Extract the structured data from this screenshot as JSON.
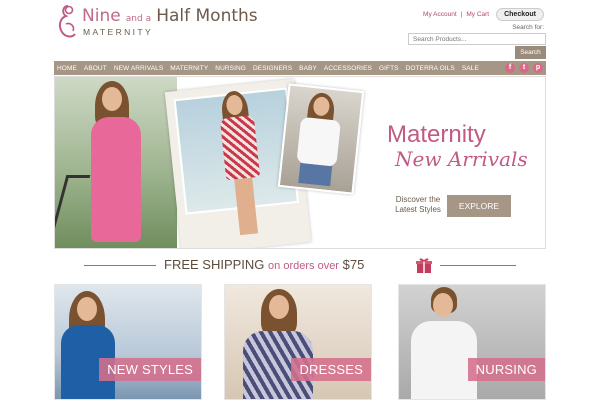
{
  "brand": {
    "name_part1": "Nine",
    "name_connector": "and a",
    "name_part2": "Half Months",
    "tagline": "MATERNITY",
    "accent_color": "#c25a86",
    "nav_color": "#a59686"
  },
  "header": {
    "my_account": "My Account",
    "separator": "|",
    "my_cart": "My Cart",
    "checkout": "Checkout",
    "search_for": "Search for:",
    "search_placeholder": "Search Products...",
    "search_button": "Search"
  },
  "nav": {
    "items": [
      "HOME",
      "ABOUT",
      "NEW ARRIVALS",
      "MATERNITY",
      "NURSING",
      "DESIGNERS",
      "BABY",
      "ACCESSORIES",
      "GIFTS",
      "DOTERRA OILS",
      "SALE"
    ],
    "social": [
      "f",
      "t",
      "p"
    ],
    "social_icons": [
      "facebook-icon",
      "twitter-icon",
      "pinterest-icon"
    ]
  },
  "hero": {
    "title": "Maternity",
    "subtitle": "New Arrivals",
    "discover_line1": "Discover the",
    "discover_line2": "Latest Styles",
    "cta": "EXPLORE"
  },
  "shipping": {
    "free": "FREE SHIPPING",
    "middle": "on orders over",
    "amount": "$75",
    "icon": "gift-icon"
  },
  "categories": [
    {
      "label": "NEW STYLES"
    },
    {
      "label": "DRESSES"
    },
    {
      "label": "NURSING"
    }
  ]
}
